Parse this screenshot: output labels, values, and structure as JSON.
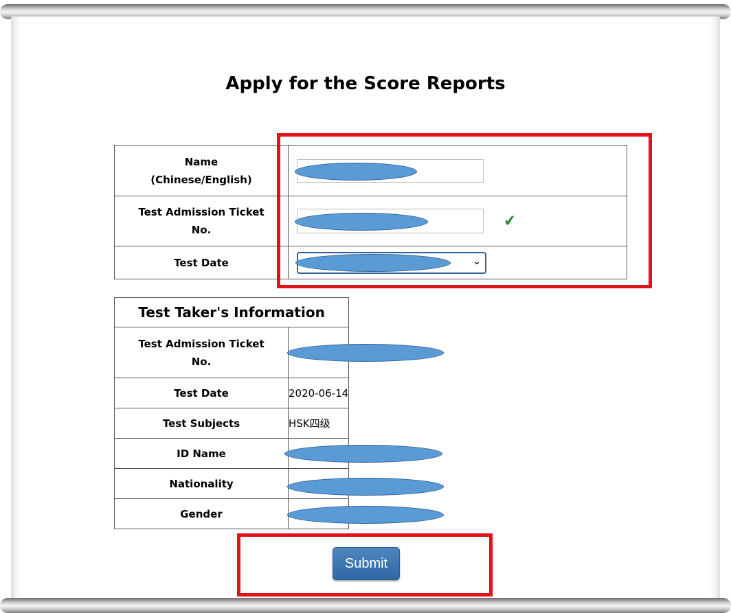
{
  "page": {
    "title": "Apply for the Score Reports"
  },
  "form": {
    "name_label_line1": "Name",
    "name_label_line2": "(Chinese/English)",
    "ticket_label_line1": "Test Admission Ticket",
    "ticket_label_line2": "No.",
    "date_label": "Test Date"
  },
  "info": {
    "header": "Test Taker's Information",
    "rows": [
      {
        "label_line1": "Test Admission Ticket",
        "label_line2": "No.",
        "value": ""
      },
      {
        "label": "Test Date",
        "value": "2020-06-14"
      },
      {
        "label": "Test Subjects",
        "value": "HSK四级"
      },
      {
        "label": "ID Name",
        "value": ""
      },
      {
        "label": "Nationality",
        "value": ""
      },
      {
        "label": "Gender",
        "value": ""
      }
    ]
  },
  "submit_label": "Submit",
  "colors": {
    "redaction": "#5b9bd5",
    "highlight": "#e0131b",
    "button": "#3a74b0",
    "check": "#2e8b2e"
  },
  "icons": [
    "checkmark-icon",
    "chevron-down-icon"
  ]
}
